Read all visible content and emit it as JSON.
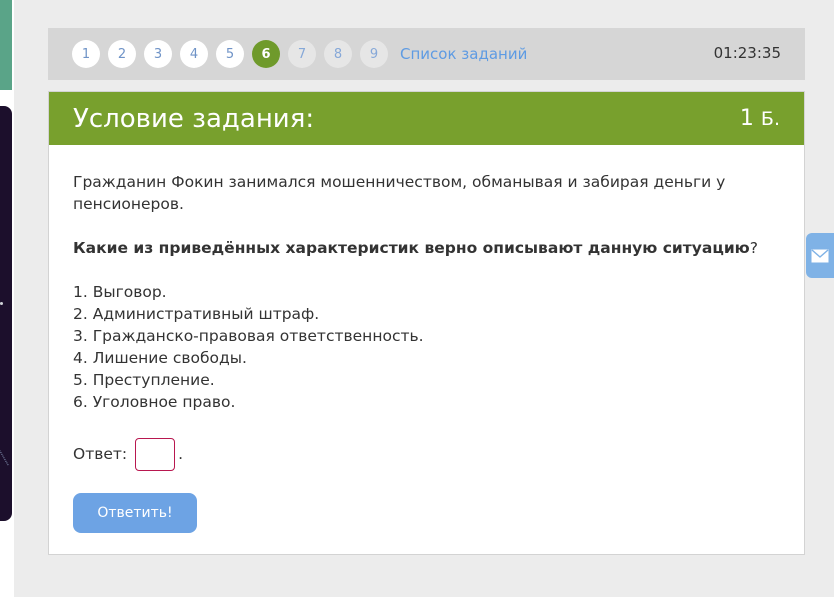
{
  "nav": {
    "tasks": [
      {
        "num": "1",
        "state": "done"
      },
      {
        "num": "2",
        "state": "done"
      },
      {
        "num": "3",
        "state": "done"
      },
      {
        "num": "4",
        "state": "done"
      },
      {
        "num": "5",
        "state": "done"
      },
      {
        "num": "6",
        "state": "active"
      },
      {
        "num": "7",
        "state": "future"
      },
      {
        "num": "8",
        "state": "future"
      },
      {
        "num": "9",
        "state": "future"
      }
    ],
    "task_list_label": "Список заданий",
    "timer": "01:23:35"
  },
  "card": {
    "title": "Условие задания:",
    "score_value": "1",
    "score_unit": "Б.",
    "paragraph": "Гражданин Фокин занимался мошенничеством, обманывая и забирая деньги у пенсионеров.",
    "question_bold": "Какие из приведённых характеристик верно описывают данную ситуацию",
    "question_mark": "?",
    "options": [
      "1. Выговор.",
      "2. Административный штраф.",
      "3. Гражданско-правовая ответственность.",
      "4. Лишение свободы.",
      "5. Преступление.",
      "6. Уголовное право."
    ],
    "answer_label": "Ответ:",
    "answer_value": "",
    "answer_suffix": ".",
    "submit_label": "Ответить!"
  },
  "colors": {
    "header_green": "#78a02d",
    "active_task": "#6f9a2b",
    "link_blue": "#5e9be3",
    "button_blue": "#6da3e4",
    "input_border": "#b8174f"
  },
  "icons": {
    "mail_tab": "mail-icon"
  }
}
